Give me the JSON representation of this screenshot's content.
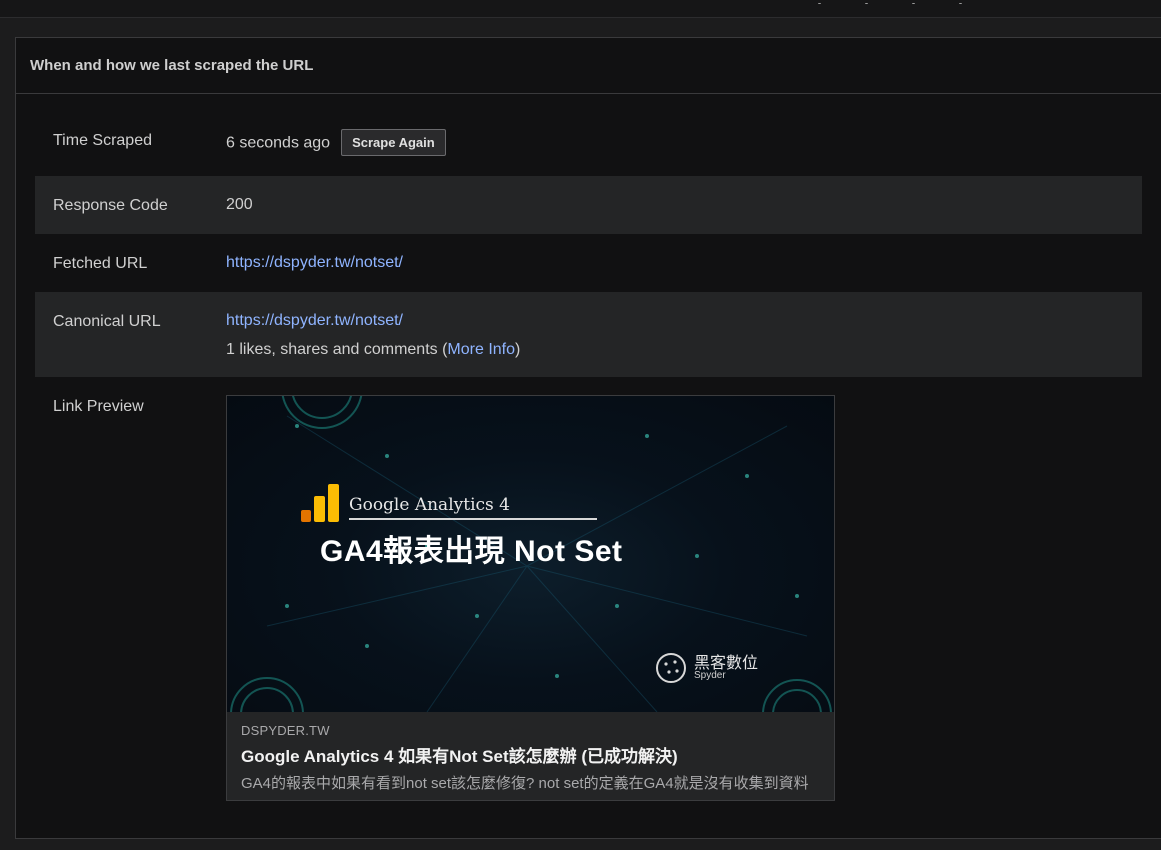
{
  "section": {
    "title": "When and how we last scraped the URL"
  },
  "rows": {
    "time_scraped": {
      "label": "Time Scraped",
      "value": "6 seconds ago",
      "button": "Scrape Again"
    },
    "response_code": {
      "label": "Response Code",
      "value": "200"
    },
    "fetched_url": {
      "label": "Fetched URL",
      "value": "https://dspyder.tw/notset/"
    },
    "canonical_url": {
      "label": "Canonical URL",
      "value": "https://dspyder.tw/notset/",
      "engagement_prefix": "1 likes, shares and comments (",
      "more_info": "More Info",
      "engagement_suffix": ")"
    },
    "link_preview": {
      "label": "Link Preview",
      "image": {
        "overline": "Google Analytics 4",
        "headline": "GA4報表出現 Not Set",
        "brand_cn": "黑客數位",
        "brand_en": "Spyder",
        "colors": {
          "bar_light": "#fbbc04",
          "bar_dark": "#e37400",
          "circuit": "#1f8f86"
        }
      },
      "domain": "DSPYDER.TW",
      "title": "Google Analytics 4 如果有Not Set該怎麼辦 (已成功解決)",
      "description": "GA4的報表中如果有看到not set該怎麼修復? not set的定義在GA4就是沒有收集到資料"
    }
  }
}
